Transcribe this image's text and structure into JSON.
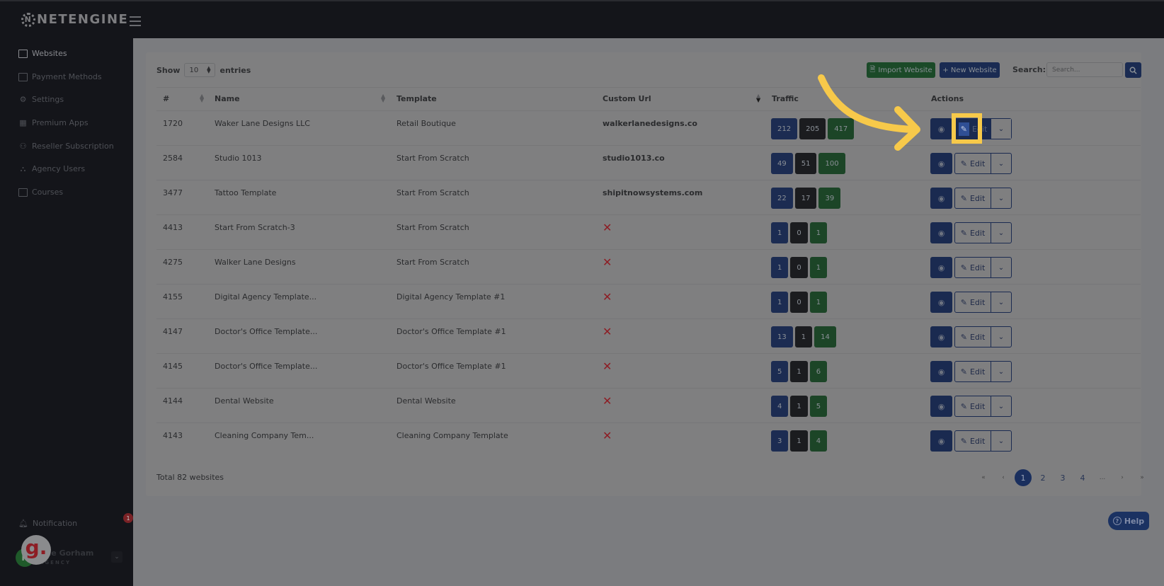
{
  "app": {
    "brand": "NETENGINE"
  },
  "sidebar": {
    "items": [
      {
        "label": "Websites",
        "icon": "browser-window-icon",
        "active": true
      },
      {
        "label": "Payment Methods",
        "icon": "credit-card-icon",
        "active": false
      },
      {
        "label": "Settings",
        "icon": "gear-icon",
        "active": false
      },
      {
        "label": "Premium Apps",
        "icon": "apps-icon",
        "active": false
      },
      {
        "label": "Reseller Subscription",
        "icon": "user-plus-icon",
        "active": false
      },
      {
        "label": "Agency Users",
        "icon": "users-icon",
        "active": false
      },
      {
        "label": "Courses",
        "icon": "video-icon",
        "active": false
      }
    ],
    "notification": {
      "label": "Notification",
      "count": "1"
    },
    "user": {
      "initial": "K",
      "name": "...ie Gorham",
      "role": "AGENCY"
    }
  },
  "toolbar": {
    "show_label": "Show",
    "entries_value": "10",
    "entries_label": "entries",
    "import_label": "Import Website",
    "new_label": "+ New Website",
    "search_label": "Search:",
    "search_placeholder": "Search..."
  },
  "table": {
    "columns": [
      "#",
      "Name",
      "Template",
      "Custom Url",
      "Traffic",
      "Actions"
    ],
    "edit_label": "Edit",
    "rows": [
      {
        "id": "1720",
        "name": "Waker Lane Designs LLC",
        "template": "Retail Boutique",
        "url": "walkerlanedesigns.co",
        "traffic": [
          "212",
          "205",
          "417"
        ]
      },
      {
        "id": "2584",
        "name": "Studio 1013",
        "template": "Start From Scratch",
        "url": "studio1013.co",
        "traffic": [
          "49",
          "51",
          "100"
        ]
      },
      {
        "id": "3477",
        "name": "Tattoo Template",
        "template": "Start From Scratch",
        "url": "shipitnowsystems.com",
        "traffic": [
          "22",
          "17",
          "39"
        ]
      },
      {
        "id": "4413",
        "name": "Start From Scratch-3",
        "template": "Start From Scratch",
        "url": null,
        "traffic": [
          "1",
          "0",
          "1"
        ]
      },
      {
        "id": "4275",
        "name": "Walker Lane Designs",
        "template": "Start From Scratch",
        "url": null,
        "traffic": [
          "1",
          "0",
          "1"
        ]
      },
      {
        "id": "4155",
        "name": "Digital Agency Template...",
        "template": "Digital Agency Template #1",
        "url": null,
        "traffic": [
          "1",
          "0",
          "1"
        ]
      },
      {
        "id": "4147",
        "name": "Doctor's Office Template...",
        "template": "Doctor's Office Template #1",
        "url": null,
        "traffic": [
          "13",
          "1",
          "14"
        ]
      },
      {
        "id": "4145",
        "name": "Doctor's Office Template...",
        "template": "Doctor's Office Template #1",
        "url": null,
        "traffic": [
          "5",
          "1",
          "6"
        ]
      },
      {
        "id": "4144",
        "name": "Dental Website",
        "template": "Dental Website",
        "url": null,
        "traffic": [
          "4",
          "1",
          "5"
        ]
      },
      {
        "id": "4143",
        "name": "Cleaning Company Tem...",
        "template": "Cleaning Company Template",
        "url": null,
        "traffic": [
          "3",
          "1",
          "4"
        ]
      }
    ]
  },
  "footer": {
    "total": "Total 82 websites",
    "pagination": [
      "«",
      "‹",
      "1",
      "2",
      "3",
      "4",
      "...",
      "›",
      "»"
    ],
    "current_page": "1"
  },
  "help": {
    "label": "Help"
  },
  "colors": {
    "primary": "#1a2a50",
    "success": "#1c4527",
    "dark": "#1b1c1f",
    "danger": "#8d1d24",
    "annotation": "#f7c94a"
  }
}
